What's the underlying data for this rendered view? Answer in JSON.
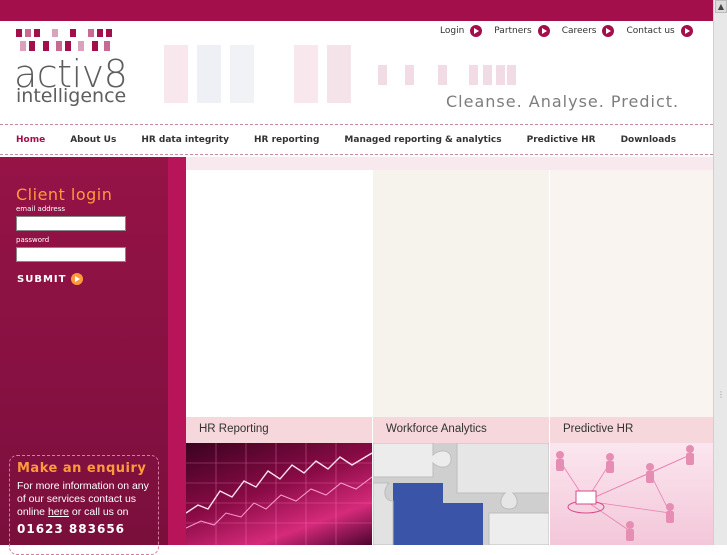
{
  "header": {
    "logo_line1": "activ8",
    "logo_line2": "intelligence",
    "tagline": "Cleanse. Analyse. Predict.",
    "top_links": [
      "Login",
      "Partners",
      "Careers",
      "Contact us"
    ]
  },
  "nav": {
    "items": [
      "Home",
      "About Us",
      "HR data integrity",
      "HR reporting",
      "Managed reporting & analytics",
      "Predictive HR",
      "Downloads"
    ],
    "active": "Home"
  },
  "login": {
    "title": "Client login",
    "email_label": "email address",
    "password_label": "password",
    "submit_label": "SUBMIT"
  },
  "enquiry": {
    "title": "Make an enquiry",
    "body_before_link": "For more information on any of our services contact us online",
    "link_text": "here",
    "body_after_link": "or call us on",
    "phone": "01623 883656"
  },
  "columns": [
    {
      "title": "HR Reporting"
    },
    {
      "title": "Workforce Analytics"
    },
    {
      "title": "Predictive HR"
    }
  ],
  "colors": {
    "brand": "#a30f4b",
    "accent": "#ff9a3c",
    "sidebar": "#871142",
    "tab": "#f5d7dc"
  }
}
